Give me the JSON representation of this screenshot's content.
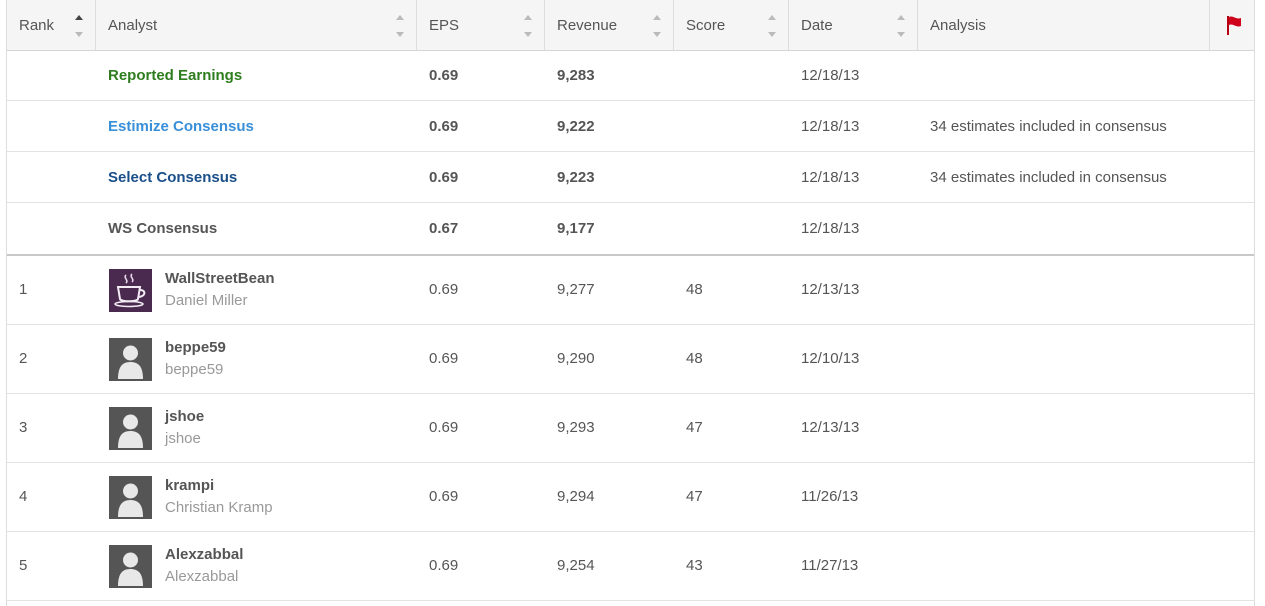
{
  "columns": [
    {
      "label": "Rank",
      "sortable": true,
      "active": true
    },
    {
      "label": "Analyst",
      "sortable": true
    },
    {
      "label": "EPS",
      "sortable": true
    },
    {
      "label": "Revenue",
      "sortable": true
    },
    {
      "label": "Score",
      "sortable": true
    },
    {
      "label": "Date",
      "sortable": true
    },
    {
      "label": "Analysis",
      "sortable": false
    }
  ],
  "flag_icon": "red-flag-icon",
  "colors": {
    "reported": "#2e7d1e",
    "estimize": "#3a8fd9",
    "select": "#1a4f8a",
    "ws": "#555555",
    "flag": "#d0021b"
  },
  "consensus": [
    {
      "label": "Reported Earnings",
      "eps": "0.69",
      "revenue": "9,283",
      "date": "12/18/13",
      "analysis": ""
    },
    {
      "label": "Estimize Consensus",
      "eps": "0.69",
      "revenue": "9,222",
      "date": "12/18/13",
      "analysis": "34 estimates included in consensus"
    },
    {
      "label": "Select Consensus",
      "eps": "0.69",
      "revenue": "9,223",
      "date": "12/18/13",
      "analysis": "34 estimates included in consensus"
    },
    {
      "label": "WS Consensus",
      "eps": "0.67",
      "revenue": "9,177",
      "date": "12/18/13",
      "analysis": ""
    }
  ],
  "analysts": [
    {
      "rank": "1",
      "username": "WallStreetBean",
      "realname": "Daniel Miller",
      "eps": "0.69",
      "revenue": "9,277",
      "score": "48",
      "date": "12/13/13",
      "avatar": "coffee-cup-avatar"
    },
    {
      "rank": "2",
      "username": "beppe59",
      "realname": "beppe59",
      "eps": "0.69",
      "revenue": "9,290",
      "score": "48",
      "date": "12/10/13",
      "avatar": "default-person-avatar"
    },
    {
      "rank": "3",
      "username": "jshoe",
      "realname": "jshoe",
      "eps": "0.69",
      "revenue": "9,293",
      "score": "47",
      "date": "12/13/13",
      "avatar": "default-person-avatar"
    },
    {
      "rank": "4",
      "username": "krampi",
      "realname": "Christian Kramp",
      "eps": "0.69",
      "revenue": "9,294",
      "score": "47",
      "date": "11/26/13",
      "avatar": "default-person-avatar"
    },
    {
      "rank": "5",
      "username": "Alexzabbal",
      "realname": "Alexzabbal",
      "eps": "0.69",
      "revenue": "9,254",
      "score": "43",
      "date": "11/27/13",
      "avatar": "default-person-avatar"
    }
  ]
}
